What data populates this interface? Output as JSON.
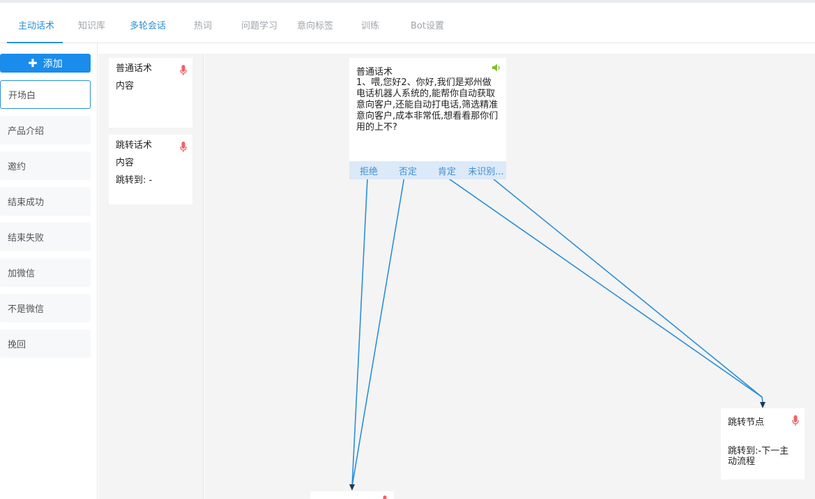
{
  "tabs": [
    {
      "label": "主动话术",
      "active": true
    },
    {
      "label": "知识库"
    },
    {
      "label": "多轮会话",
      "accent": true
    },
    {
      "label": "热词"
    },
    {
      "label": "问题学习"
    },
    {
      "label": "意向标签"
    },
    {
      "label": "训练"
    },
    {
      "label": "Bot设置"
    }
  ],
  "sidebar": {
    "add_label": "添加",
    "items": [
      "开场白",
      "产品介绍",
      "邀约",
      "结束成功",
      "结束失败",
      "加微信",
      "不是微信",
      "挽回"
    ],
    "active_index": 0
  },
  "palette": {
    "normal": {
      "title": "普通话术",
      "content": "内容"
    },
    "jump": {
      "title": "跳转话术",
      "content": "内容",
      "jump": "跳转到: -"
    }
  },
  "canvas": {
    "main_node": {
      "title": "普通话术",
      "content": "1、喂,您好2、你好,我们是郑州做电话机器人系统的,能帮你自动获取意向客户,还能自动打电话,筛选精准意向客户,成本非常低,想看看那你们用的上不?",
      "branches": [
        "拒绝",
        "否定",
        "肯定",
        "未识别..."
      ]
    },
    "jump_node": {
      "title": "跳转节点",
      "jump": "跳转到:-下一主动流程"
    }
  },
  "colors": {
    "accent": "#2a8fd8",
    "add_button": "#1a8cec",
    "mic": "#f0616b",
    "speaker": "#7bbf2a",
    "line": "#2a8fd8"
  }
}
